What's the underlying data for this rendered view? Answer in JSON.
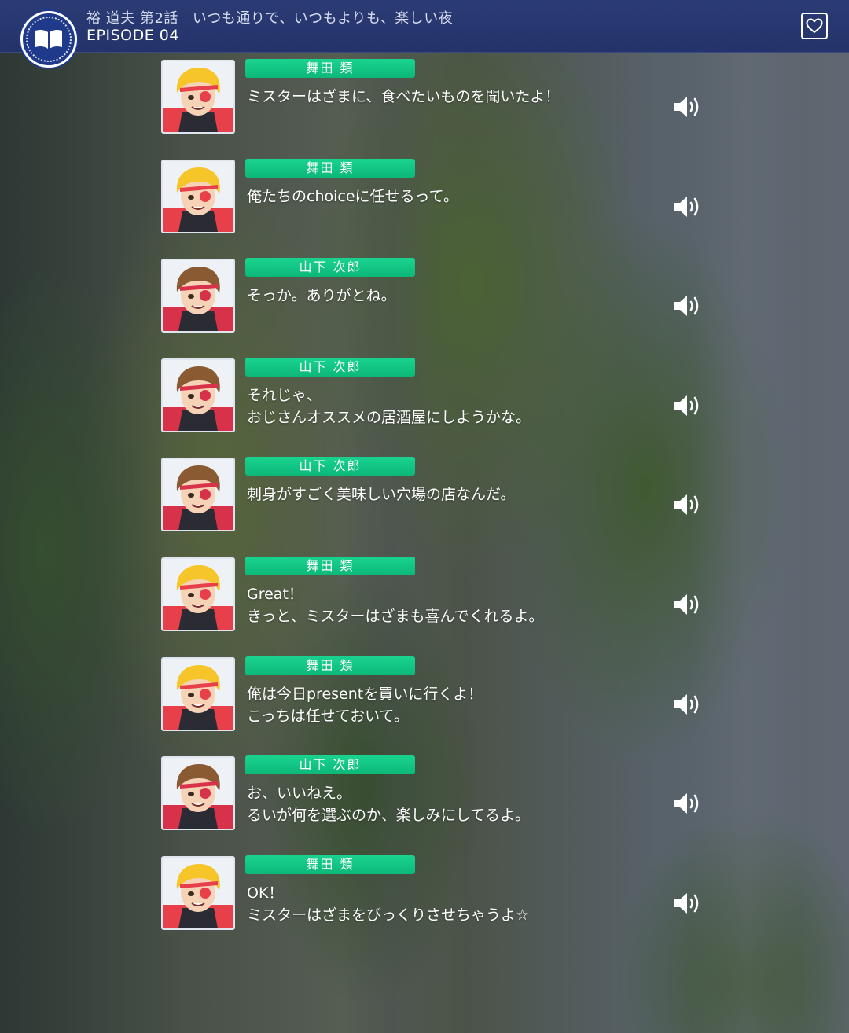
{
  "header": {
    "chapter": "裕 道夫 第2話",
    "title": "いつも通りで、いつもよりも、楽しい夜",
    "episode": "EPISODE 04",
    "book_icon": "book-icon",
    "favorite_icon": "heart-icon"
  },
  "colors": {
    "header_bg": "#24336a",
    "name_tag": "#12c685",
    "text": "#ffffff"
  },
  "characters": {
    "rui": {
      "name": "舞田 類",
      "hair": "#f5c52a",
      "mask": "#e8404a"
    },
    "jiro": {
      "name": "山下 次郎",
      "hair": "#8a5a33",
      "mask": "#d8324a"
    }
  },
  "entries": [
    {
      "speaker": "舞田 類",
      "char": "rui",
      "text": "ミスターはざまに、食べたいものを聞いたよ！"
    },
    {
      "speaker": "舞田 類",
      "char": "rui",
      "text": "俺たちのchoiceに任せるって。"
    },
    {
      "speaker": "山下 次郎",
      "char": "jiro",
      "text": "そっか。ありがとね。"
    },
    {
      "speaker": "山下 次郎",
      "char": "jiro",
      "text": "それじゃ、\nおじさんオススメの居酒屋にしようかな。"
    },
    {
      "speaker": "山下 次郎",
      "char": "jiro",
      "text": "刺身がすごく美味しい穴場の店なんだ。"
    },
    {
      "speaker": "舞田 類",
      "char": "rui",
      "text": "Great！\nきっと、ミスターはざまも喜んでくれるよ。"
    },
    {
      "speaker": "舞田 類",
      "char": "rui",
      "text": "俺は今日presentを買いに行くよ！\nこっちは任せておいて。"
    },
    {
      "speaker": "山下 次郎",
      "char": "jiro",
      "text": "お、いいねえ。\nるいが何を選ぶのか、楽しみにしてるよ。"
    },
    {
      "speaker": "舞田 類",
      "char": "rui",
      "text": "OK！\nミスターはざまをびっくりさせちゃうよ☆"
    }
  ],
  "voice_icon": "speaker-icon"
}
